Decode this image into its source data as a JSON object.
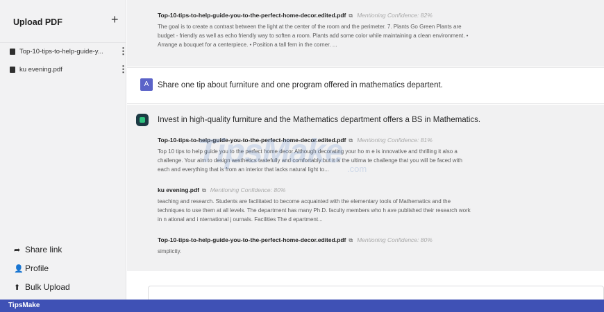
{
  "sidebar": {
    "title": "Upload PDF",
    "add_icon": "+",
    "files": [
      {
        "name": "Top-10-tips-to-help-guide-y..."
      },
      {
        "name": "ku evening.pdf"
      }
    ],
    "links": [
      {
        "icon": "share-icon",
        "glyph": "➦",
        "label": "Share link"
      },
      {
        "icon": "user-icon",
        "glyph": "👤",
        "label": "Profile"
      },
      {
        "icon": "upload-icon",
        "glyph": "⬆",
        "label": "Bulk Upload"
      }
    ]
  },
  "conversation": {
    "prev_source": {
      "name": "Top-10-tips-to-help-guide-you-to-the-perfect-home-decor.edited.pdf",
      "confidence": "Mentioning Confidence: 82%",
      "text": "The goal is to create a contrast between the light at the center of the room and the perimeter. 7. Plants Go Green Plants are budget - friendly as well as echo friendly way to soften a room. Plants add some color while maintaining a clean environment. • Arrange a bouquet for a centerpiece. • Position a tall fern in the corner. ..."
    },
    "question": {
      "avatar": "A",
      "text": "Share one tip about furniture and one program offered in mathematics departent."
    },
    "answer": {
      "text": "Invest in high-quality furniture and the Mathematics department offers a BS in Mathematics.",
      "sources": [
        {
          "name": "Top-10-tips-to-help-guide-you-to-the-perfect-home-decor.edited.pdf",
          "confidence": "Mentioning Confidence: 81%",
          "text": "Top 10 tips to help guide you to the perfect home decor Although decorating your ho m e is innovative and thrilling it also a challenge. Your aim to design aesthetics tastefully and comfortably but it is the ultima te challenge that you will be faced with each and everything that is from an interior that lacks natural light to..."
        },
        {
          "name": "ku evening.pdf",
          "confidence": "Mentioning Confidence: 80%",
          "text": "teaching and research. Students are facilitated to become acquainted with the elementary tools of Mathematics and the techniques to use them at all levels. The department has many Ph.D. faculty members who h ave published their research work in n ational and i nternational j ournals. Facilities The d epartment..."
        },
        {
          "name": "Top-10-tips-to-help-guide-you-to-the-perfect-home-decor.edited.pdf",
          "confidence": "Mentioning Confidence: 80%",
          "text": "simplicity."
        }
      ]
    }
  },
  "watermark": {
    "main": "TipsMake",
    "sub": ".com"
  },
  "footer": {
    "brand": "TipsMake"
  },
  "colors": {
    "accent": "#3f51b5",
    "user_avatar": "#5b63c8",
    "bot_avatar": "#1c3a44"
  }
}
